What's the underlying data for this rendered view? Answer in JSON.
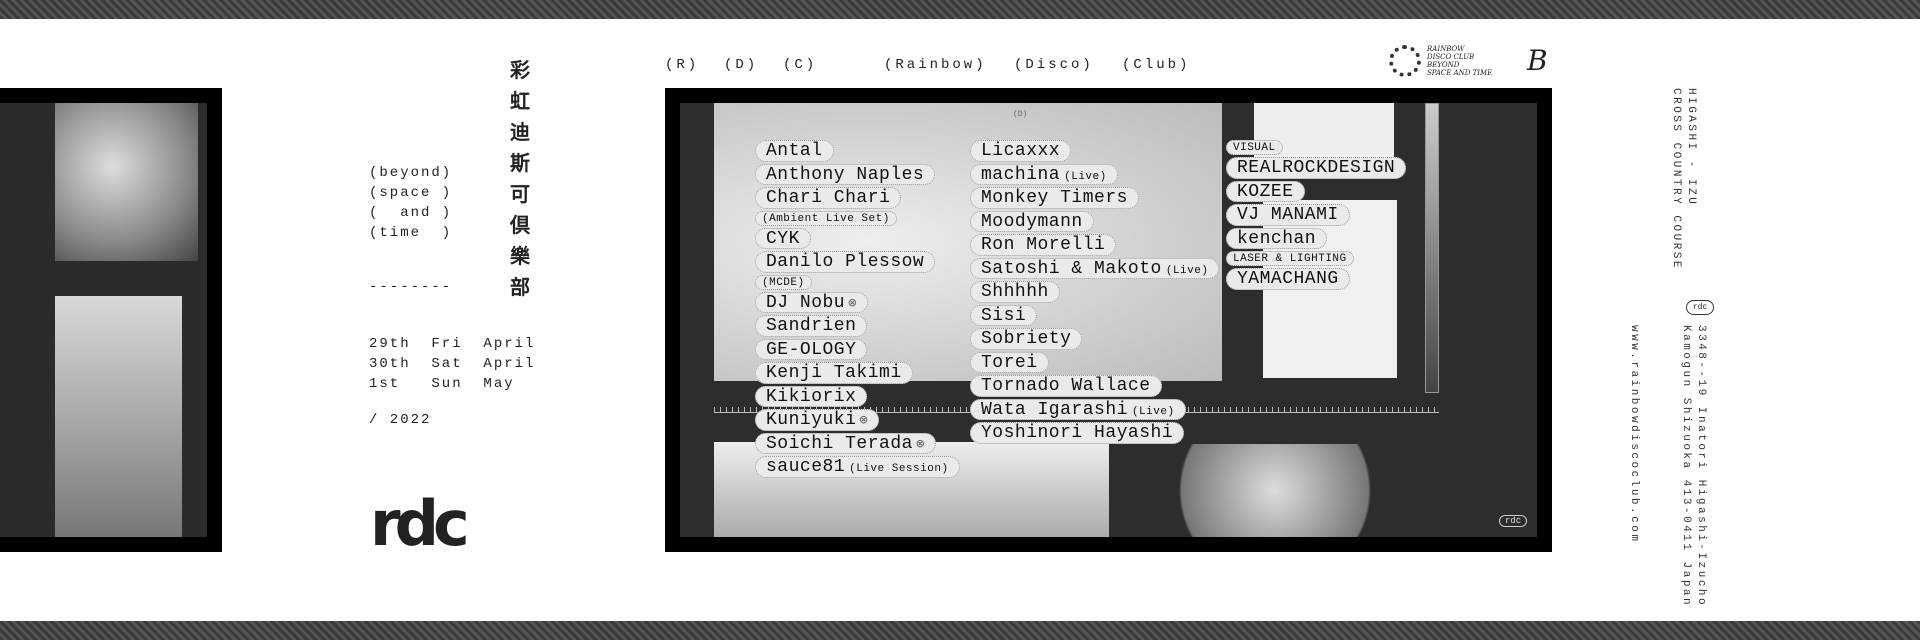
{
  "header": {
    "items": [
      "(R)",
      "(D)",
      "(C)",
      "(Rainbow)",
      "(Disco)",
      "(Club)"
    ]
  },
  "kanji": [
    "彩",
    "虹",
    "迪",
    "斯",
    "可",
    "倶",
    "樂",
    "部"
  ],
  "tagline": "(beyond)\n(space )\n(  and )\n(time  )",
  "divider": "--------",
  "dates": "29th  Fri  April\n30th  Sat  April\n1st   Sun  May",
  "year": "/ 2022",
  "logo_text": "rdc",
  "poster": {
    "d_label": "(D)",
    "badge": "rdc",
    "column1": [
      {
        "name": "Antal"
      },
      {
        "name": "Anthony Naples"
      },
      {
        "name": "Chari Chari"
      },
      {
        "note": "(Ambient Live Set)"
      },
      {
        "name": "CYK"
      },
      {
        "name": "Danilo Plessow"
      },
      {
        "note": "(MCDE)"
      },
      {
        "name": "DJ Nobu",
        "mark": "⊗"
      },
      {
        "name": "Sandrien"
      },
      {
        "name": "GE-OLOGY"
      },
      {
        "name": "Kenji Takimi"
      },
      {
        "name": "Kikiorix"
      },
      {
        "name": "Kuniyuki",
        "mark": "⊗"
      },
      {
        "name": "Soichi Terada",
        "mark": "⊗"
      },
      {
        "name": "sauce81",
        "suffix": "(Live Session)"
      }
    ],
    "column2": [
      {
        "name": "Licaxxx"
      },
      {
        "name": "machina",
        "suffix": "(Live)"
      },
      {
        "name": "Monkey Timers"
      },
      {
        "name": "Moodymann"
      },
      {
        "name": "Ron Morelli"
      },
      {
        "name": "Satoshi & Makoto",
        "suffix": "(Live)"
      },
      {
        "name": "Shhhhh"
      },
      {
        "name": "Sisi"
      },
      {
        "name": "Sobriety"
      },
      {
        "name": "Torei"
      },
      {
        "name": "Tornado Wallace"
      },
      {
        "name": "Wata Igarashi",
        "suffix": "(Live)"
      },
      {
        "name": "Yoshinori Hayashi"
      }
    ],
    "column3": [
      {
        "note": "VISUAL"
      },
      {
        "name": "REALROCKDESIGN"
      },
      {
        "name": "KOZEE"
      },
      {
        "name": "VJ MANAMI"
      },
      {
        "name": "kenchan"
      },
      {
        "note": "LASER & LIGHTING"
      },
      {
        "name": "YAMACHANG"
      }
    ]
  },
  "logos": {
    "rainbow_logo_text": "RAINBOW DISCO CLUB BEYOND SPACE AND TIME",
    "monogram": "B"
  },
  "venue": {
    "line1": "HIGASHI - IZU",
    "line2": "CROSS COUNTRY COURSE"
  },
  "address": {
    "line1": "3348--19 Inatori Higashi-Izucho",
    "line2": "Kamogun Shizuoka 413-0411 Japan",
    "badge": "rdc"
  },
  "website": "www.rainbowdiscoclub.com",
  "colors": {
    "poster_frame": "#000000",
    "poster_bg": "#2d2d2d",
    "pill": "#eaeaea",
    "text": "#222222"
  }
}
